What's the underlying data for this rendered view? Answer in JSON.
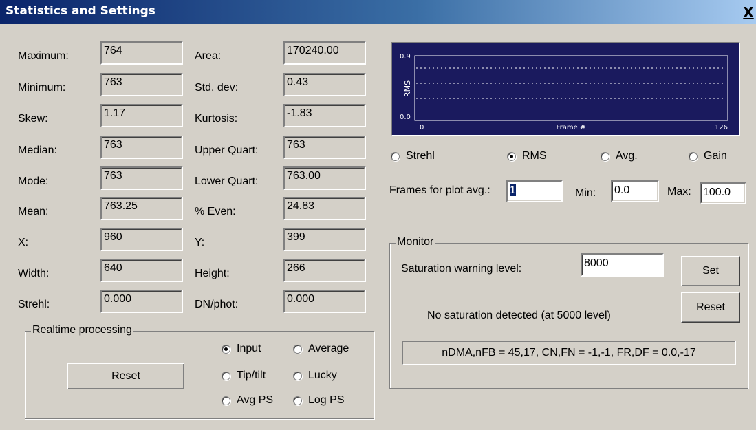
{
  "window": {
    "title": "Statistics and Settings",
    "close_label": "X"
  },
  "stats": {
    "maximum": {
      "label": "Maximum:",
      "value": "764"
    },
    "minimum": {
      "label": "Minimum:",
      "value": "763"
    },
    "skew": {
      "label": "Skew:",
      "value": "1.17"
    },
    "median": {
      "label": "Median:",
      "value": "763"
    },
    "mode": {
      "label": "Mode:",
      "value": "763"
    },
    "mean": {
      "label": "Mean:",
      "value": "763.25"
    },
    "x": {
      "label": "X:",
      "value": "960"
    },
    "width": {
      "label": "Width:",
      "value": "640"
    },
    "strehl": {
      "label": "Strehl:",
      "value": "0.000"
    },
    "area": {
      "label": "Area:",
      "value": "170240.00"
    },
    "stddev": {
      "label": "Std. dev:",
      "value": "0.43"
    },
    "kurtosis": {
      "label": "Kurtosis:",
      "value": "-1.83"
    },
    "upper_quart": {
      "label": "Upper Quart:",
      "value": "763"
    },
    "lower_quart": {
      "label": "Lower Quart:",
      "value": "763.00"
    },
    "pct_even": {
      "label": "% Even:",
      "value": "24.83"
    },
    "y": {
      "label": "Y:",
      "value": "399"
    },
    "height": {
      "label": "Height:",
      "value": "266"
    },
    "dn_phot": {
      "label": "DN/phot:",
      "value": "0.000"
    }
  },
  "realtime": {
    "legend": "Realtime processing",
    "reset_label": "Reset",
    "options": {
      "input": {
        "label": "Input",
        "checked": true
      },
      "average": {
        "label": "Average",
        "checked": false
      },
      "tiptilt": {
        "label": "Tip/tilt",
        "checked": false
      },
      "lucky": {
        "label": "Lucky",
        "checked": false
      },
      "avgps": {
        "label": "Avg PS",
        "checked": false
      },
      "logps": {
        "label": "Log PS",
        "checked": false
      }
    }
  },
  "plot": {
    "y_axis_label": "RMS",
    "x_axis_label": "Frame #",
    "y_max_label": "0.9",
    "y_min_label": "0.0",
    "x_min_label": "0",
    "x_max_label": "126",
    "colors": {
      "background": "#1a1a5e",
      "axes": "#ffffff",
      "grid": "#ffffff"
    }
  },
  "plot_mode": {
    "strehl": {
      "label": "Strehl",
      "checked": false
    },
    "rms": {
      "label": "RMS",
      "checked": true
    },
    "avg": {
      "label": "Avg.",
      "checked": false
    },
    "gain": {
      "label": "Gain",
      "checked": false
    }
  },
  "plot_settings": {
    "frames_label": "Frames for plot avg.:",
    "frames_value": "1",
    "min_label": "Min:",
    "min_value": "0.0",
    "max_label": "Max:",
    "max_value": "100.0"
  },
  "monitor": {
    "legend": "Monitor",
    "saturation_label": "Saturation warning level:",
    "saturation_value": "8000",
    "set_label": "Set",
    "reset_label": "Reset",
    "status_text": "No saturation detected (at 5000 level)",
    "info_text": "nDMA,nFB = 45,17, CN,FN = -1,-1, FR,DF = 0.0,-17"
  }
}
